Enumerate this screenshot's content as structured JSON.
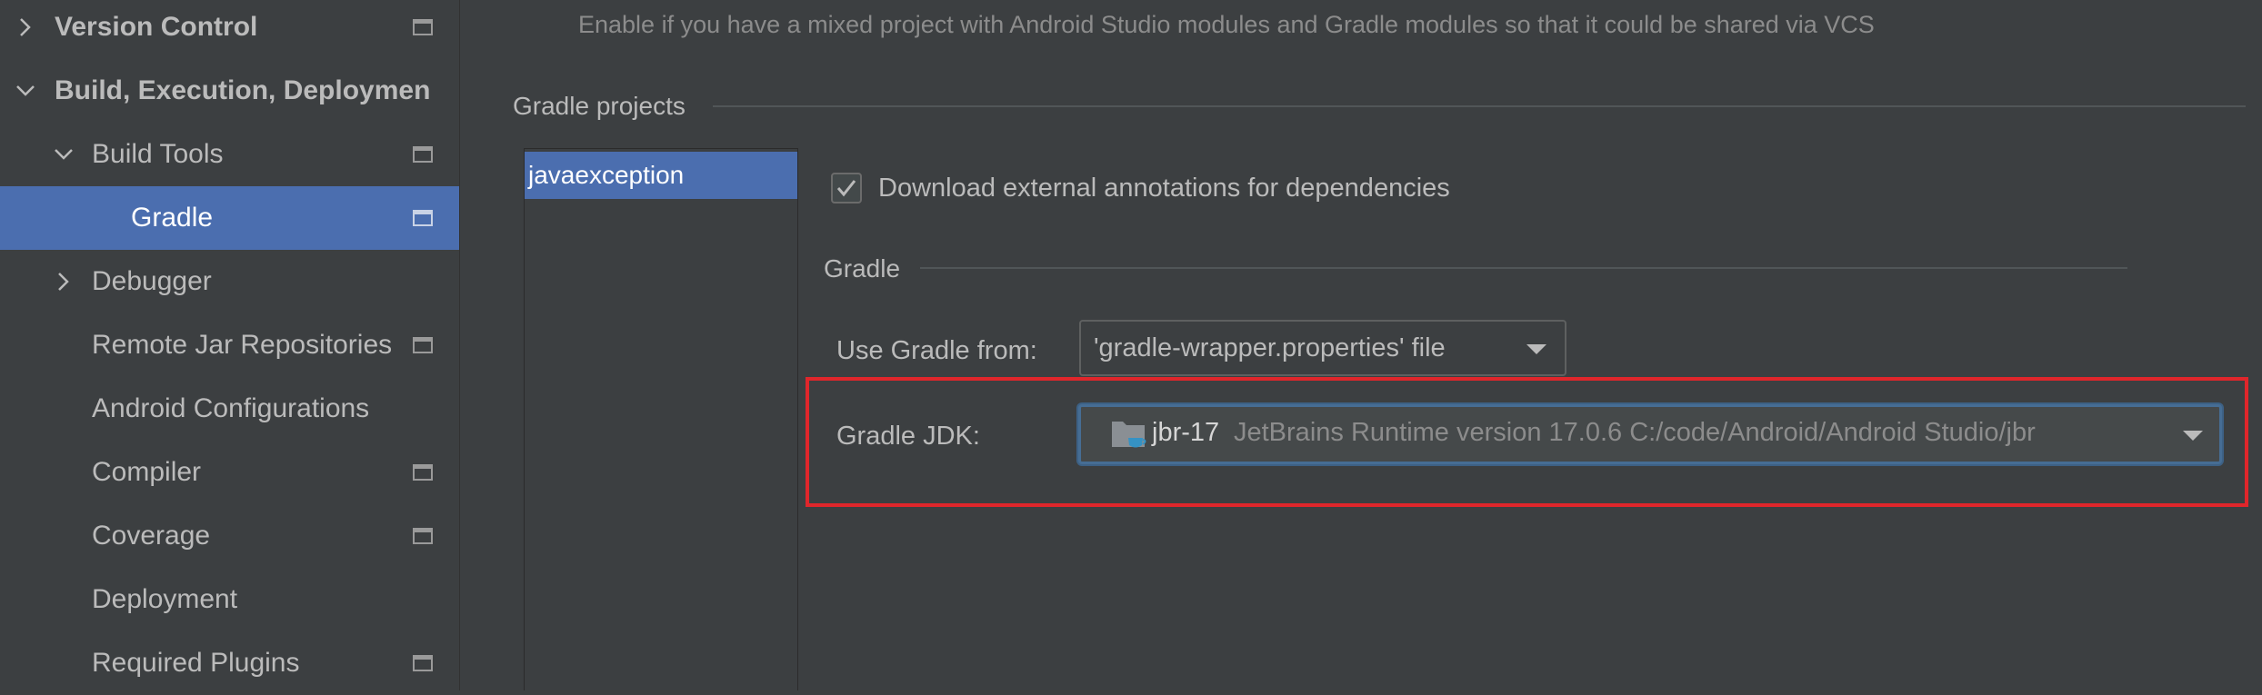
{
  "sidebar": {
    "items": [
      {
        "label": "Version Control",
        "expanded": false,
        "bold": true,
        "scope_icon": true
      },
      {
        "label": "Build, Execution, Deploymen",
        "expanded": true,
        "bold": true,
        "scope_icon": false
      },
      {
        "label": "Build Tools",
        "expanded": true,
        "bold": false,
        "scope_icon": true
      },
      {
        "label": "Gradle",
        "selected": true,
        "scope_icon": true
      },
      {
        "label": "Debugger",
        "expanded": false,
        "scope_icon": false
      },
      {
        "label": "Remote Jar Repositories",
        "scope_icon": true
      },
      {
        "label": "Android Configurations",
        "scope_icon": false
      },
      {
        "label": "Compiler",
        "scope_icon": true
      },
      {
        "label": "Coverage",
        "scope_icon": true
      },
      {
        "label": "Deployment",
        "scope_icon": false
      },
      {
        "label": "Required Plugins",
        "scope_icon": true
      }
    ]
  },
  "main": {
    "hint": "Enable if you have a mixed project with Android Studio modules and Gradle modules so that it could be shared via VCS",
    "gradle_projects_title": "Gradle projects",
    "projects": [
      "javaexception"
    ],
    "download_annotations": {
      "label": "Download external annotations for dependencies",
      "checked": true
    },
    "gradle_section_title": "Gradle",
    "use_gradle_from": {
      "label": "Use Gradle from:",
      "value": "'gradle-wrapper.properties' file"
    },
    "gradle_jdk": {
      "label": "Gradle JDK:",
      "name": "jbr-17",
      "description": "JetBrains Runtime version 17.0.6 C:/code/Android/Android Studio/jbr",
      "icon": "jdk-folder-icon"
    }
  },
  "colors": {
    "background": "#3c3f41",
    "selection": "#4b6eaf",
    "highlight_border": "#e0262b",
    "focus_border": "#466d94"
  }
}
